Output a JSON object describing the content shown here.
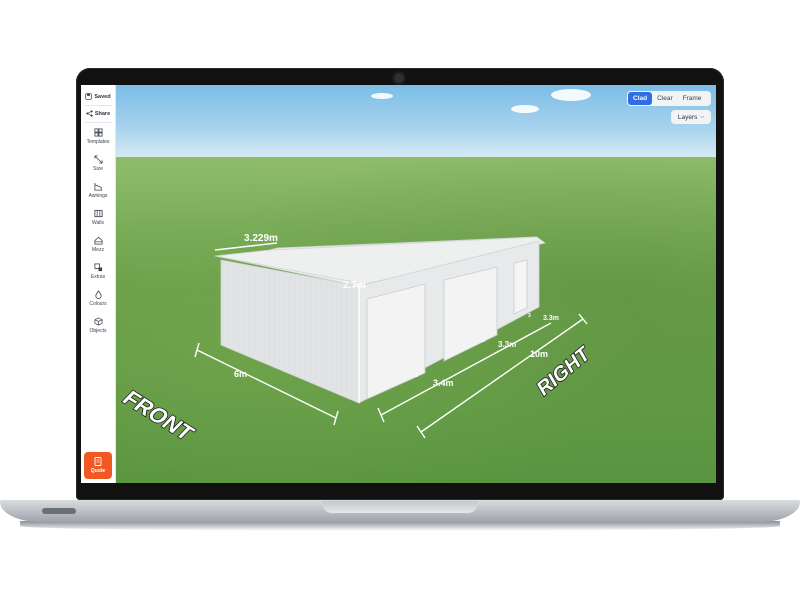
{
  "sidebar": {
    "saved_label": "Saved",
    "share_label": "Share",
    "items": [
      {
        "label": "Templates",
        "icon": "templates-icon"
      },
      {
        "label": "Size",
        "icon": "resize-icon"
      },
      {
        "label": "Awnings",
        "icon": "awning-icon"
      },
      {
        "label": "Walls",
        "icon": "walls-icon"
      },
      {
        "label": "Mezz",
        "icon": "mezzanine-icon"
      },
      {
        "label": "Extras",
        "icon": "extras-icon"
      },
      {
        "label": "Colours",
        "icon": "colour-drop-icon"
      },
      {
        "label": "Objects",
        "icon": "cube-icon"
      }
    ],
    "quote_label": "Quote"
  },
  "view_modes": {
    "options": [
      "Clad",
      "Clear",
      "Frame"
    ],
    "selected": "Clad"
  },
  "layers_label": "Layers",
  "dimensions": {
    "roof_span": "3.229m",
    "wall_height": "2.7m",
    "front_width": "6m",
    "bay_1": "3.4m",
    "bay_2": "3.3m",
    "bay_3": "3.3m",
    "total_length": "10m",
    "bay_ticks": [
      "1",
      "2",
      "3"
    ]
  },
  "ground_labels": {
    "front": "FRONT",
    "right": "RIGHT"
  },
  "colors": {
    "accent": "#2f6ce6",
    "quote": "#f05a22",
    "grass": "#6aa04a",
    "shed": "#e8e9ea"
  }
}
